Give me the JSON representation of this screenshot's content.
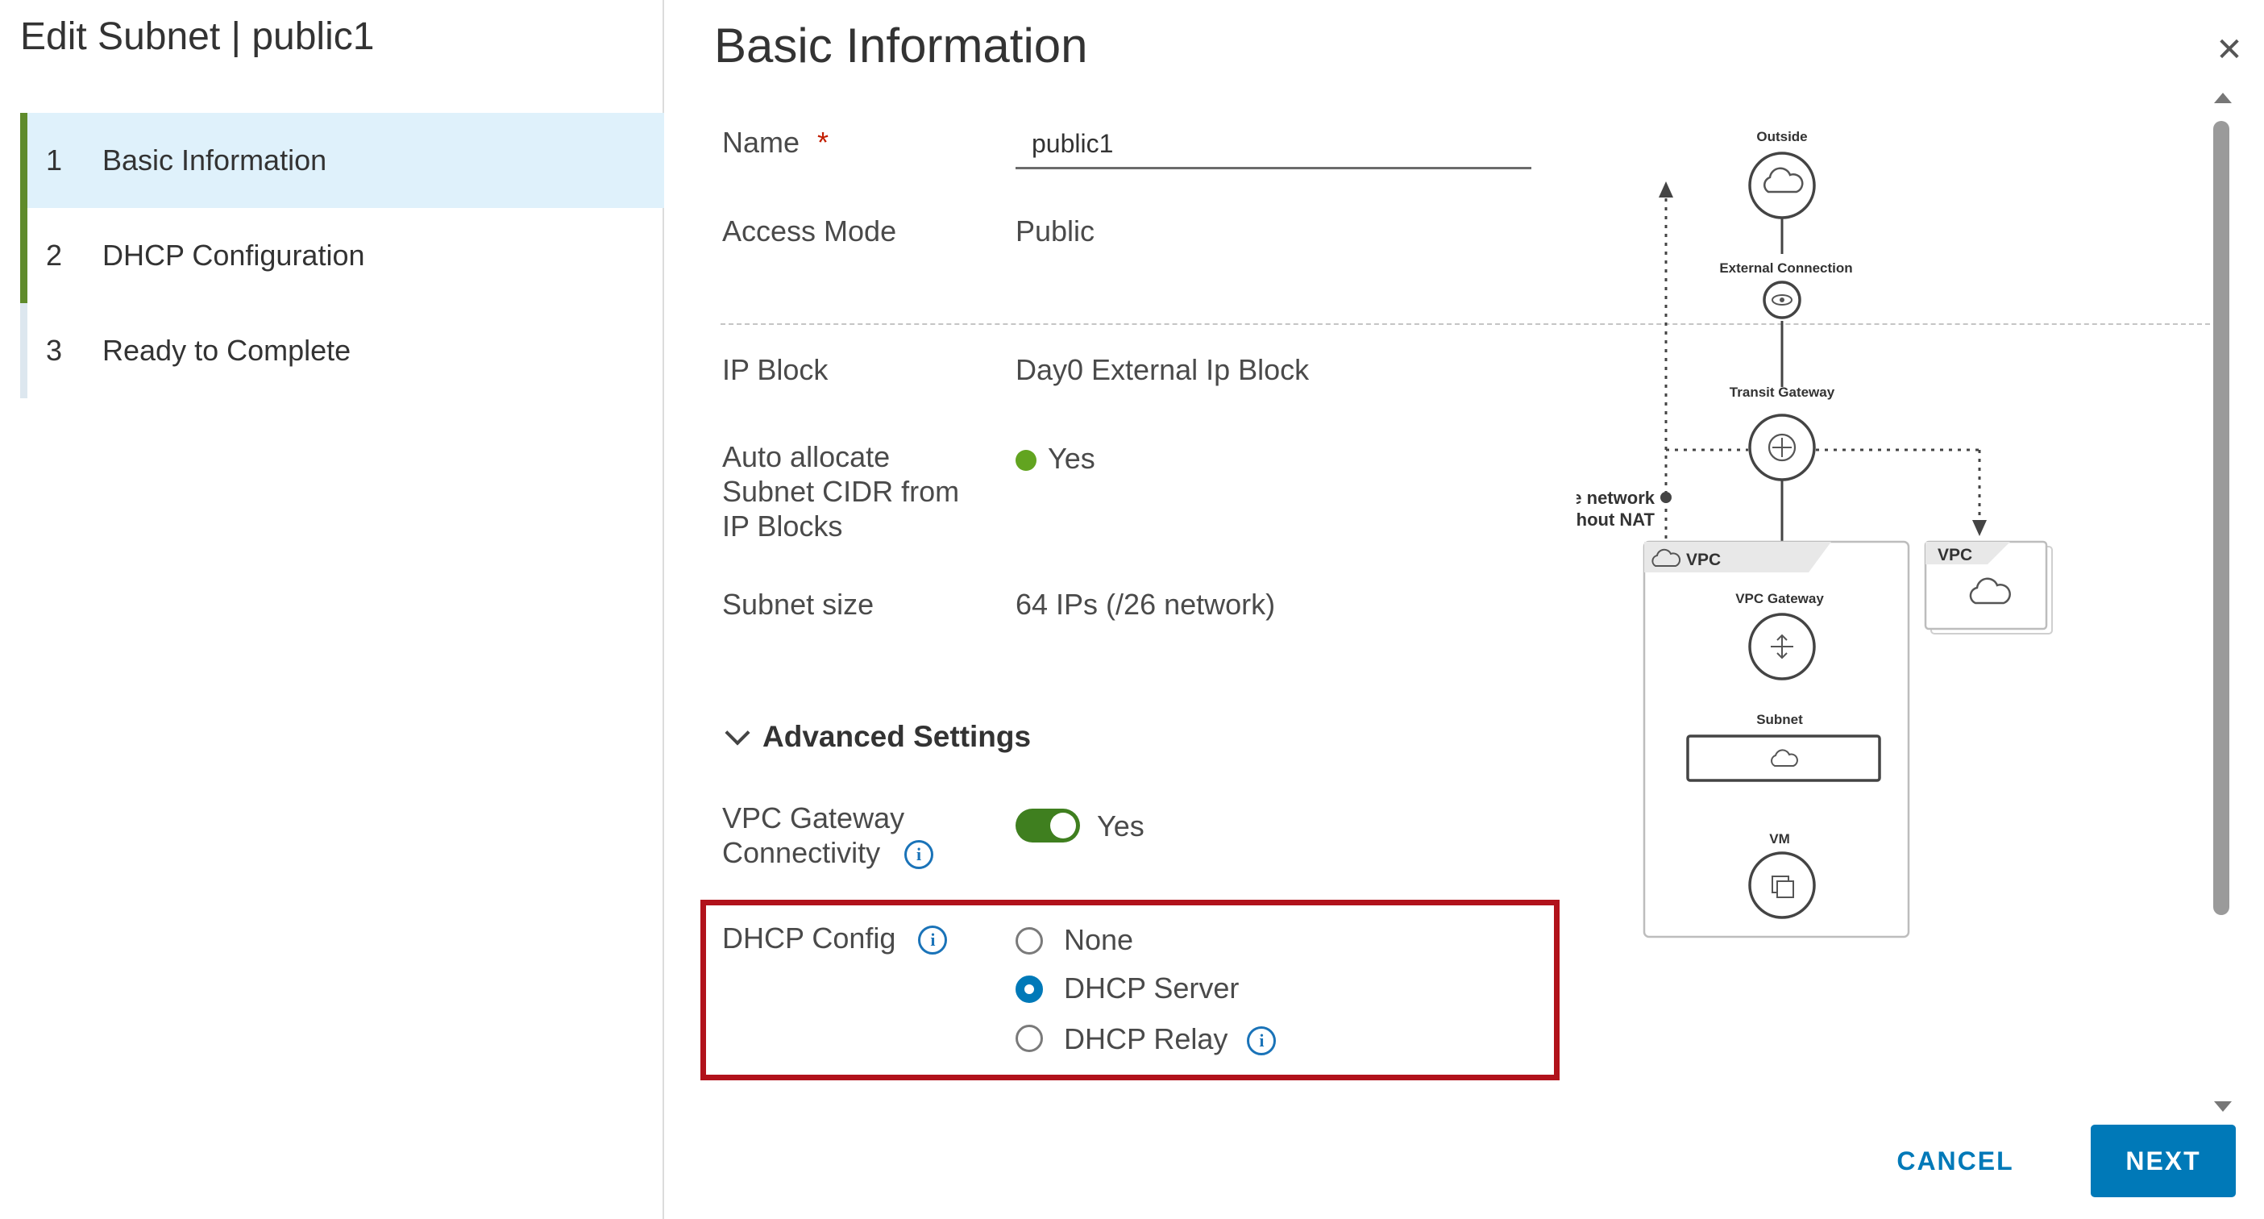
{
  "dialog": {
    "title": "Edit Subnet | public1"
  },
  "steps": [
    {
      "number": "1",
      "label": "Basic Information"
    },
    {
      "number": "2",
      "label": "DHCP Configuration"
    },
    {
      "number": "3",
      "label": "Ready to Complete"
    }
  ],
  "section_title": "Basic Information",
  "form": {
    "name_label": "Name",
    "required_marker": "*",
    "name_value": "public1",
    "access_mode_label": "Access Mode",
    "access_mode_value": "Public",
    "ip_block_label": "IP Block",
    "ip_block_value": "Day0 External Ip Block",
    "auto_allocate_label_1": "Auto allocate",
    "auto_allocate_label_2": "Subnet CIDR from",
    "auto_allocate_label_3": "IP Blocks",
    "auto_allocate_value": "Yes",
    "subnet_size_label": "Subnet size",
    "subnet_size_value": "64 IPs (/26 network)",
    "advanced_settings_label": "Advanced Settings",
    "vpc_gateway_label_1": "VPC Gateway",
    "vpc_gateway_label_2": "Connectivity",
    "vpc_gateway_value": "Yes",
    "vpc_gateway_enabled": true,
    "dhcp_config_label": "DHCP Config",
    "dhcp_options": [
      "None",
      "DHCP Server",
      "DHCP Relay"
    ],
    "dhcp_selected": "DHCP Server"
  },
  "diagram": {
    "outside": "Outside",
    "external_connection": "External Connection",
    "transit_gateway": "Transit Gateway",
    "accessible_network_1": "Accessible network",
    "accessible_network_2": "without NAT",
    "vpc": "VPC",
    "vpc_gateway": "VPC Gateway",
    "subnet": "Subnet",
    "vm": "VM",
    "vpc_secondary": "VPC"
  },
  "buttons": {
    "cancel": "CANCEL",
    "next": "NEXT"
  },
  "colors": {
    "primary": "#0079b8",
    "active_step_bg": "#dff1fb",
    "step_done_border": "#5f8b2b",
    "toggle_on": "#3f7f1f",
    "status_green": "#62a420",
    "highlight": "#b1121b"
  }
}
